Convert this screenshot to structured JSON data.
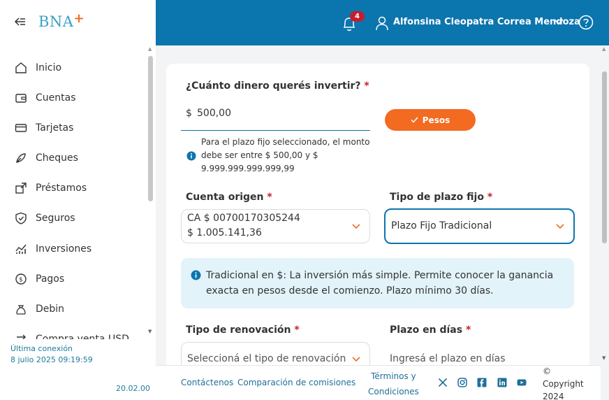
{
  "sidebar": {
    "logo_text": "BNA",
    "logo_plus": "+",
    "items": [
      {
        "label": "Inicio",
        "icon": "home-icon"
      },
      {
        "label": "Cuentas",
        "icon": "wallet-icon"
      },
      {
        "label": "Tarjetas",
        "icon": "card-icon"
      },
      {
        "label": "Cheques",
        "icon": "pen-icon"
      },
      {
        "label": "Préstamos",
        "icon": "loan-icon"
      },
      {
        "label": "Seguros",
        "icon": "shield-icon"
      },
      {
        "label": "Inversiones",
        "icon": "chart-icon"
      },
      {
        "label": "Pagos",
        "icon": "coin-icon"
      },
      {
        "label": "Debin",
        "icon": "bag-icon"
      },
      {
        "label": "Compra venta USD",
        "icon": "exchange-icon"
      }
    ],
    "last_connection_label": "Última conexión",
    "last_connection_value": "8 julio 2025 09:19:59",
    "version": "20.02.00"
  },
  "header": {
    "notifications_count": "4",
    "user_name": "Alfonsina Cleopatra Correa Mendoza"
  },
  "form": {
    "amount_label": "¿Cuánto dinero querés invertir?",
    "required_mark": "*",
    "currency_symbol": "$",
    "amount_value": "500,00",
    "currency_button": "Pesos",
    "amount_hint": "Para el plazo fijo seleccionado, el monto debe ser entre $ 500,00 y $ 9.999.999.999.999,99",
    "account_label": "Cuenta origen",
    "account_line1": "CA $ 00700170305244",
    "account_line2": "$ 1.005.141,36",
    "type_label": "Tipo de plazo fijo",
    "type_value": "Plazo Fijo Tradicional",
    "type_info": "Tradicional en $: La inversión más simple. Permite conocer la ganancia exacta en pesos desde el comienzo. Plazo mínimo 30 días.",
    "renewal_label": "Tipo de renovación",
    "renewal_placeholder": "Seleccioná el tipo de renovación",
    "days_label": "Plazo en días",
    "days_placeholder": "Ingresá el plazo en días"
  },
  "footer": {
    "contact": "Contáctenos",
    "fees": "Comparación de comisiones",
    "terms_line1": "Términos y",
    "terms_line2": "Condiciones",
    "copyright_symbol": "©",
    "copyright_line1": "Copyright",
    "copyright_line2": "2024"
  },
  "colors": {
    "header": "#0b75ae",
    "accent": "#f26b21",
    "info_bg": "#e3f3fa",
    "required": "#c41e2e"
  }
}
